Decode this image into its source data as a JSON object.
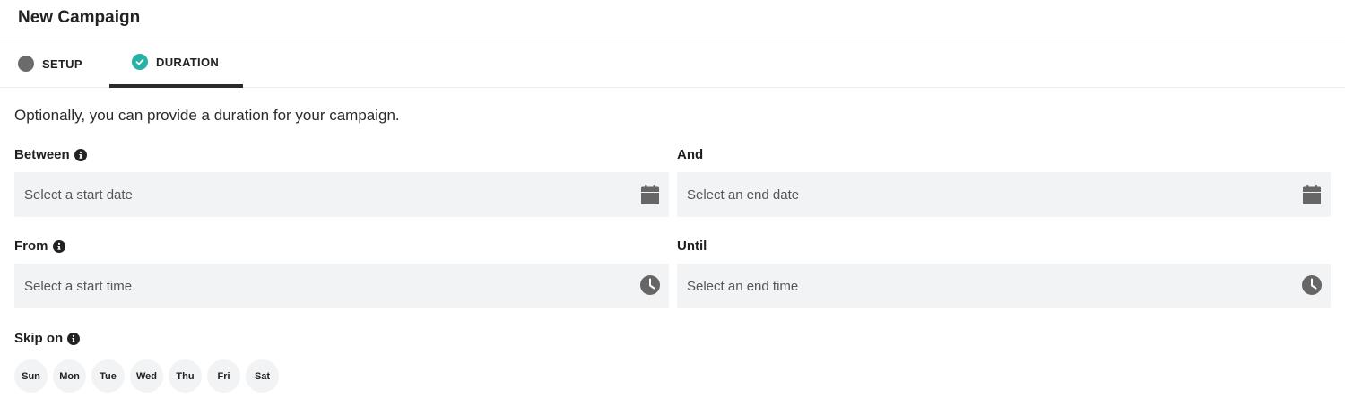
{
  "header": {
    "title": "New Campaign"
  },
  "tabs": [
    {
      "label": "SETUP",
      "icon": "status-dot-icon"
    },
    {
      "label": "DURATION",
      "icon": "check-circle-icon",
      "active": true
    }
  ],
  "intro": "Optionally, you can provide a duration for your campaign.",
  "fields": {
    "between": {
      "label": "Between",
      "placeholder": "Select a start date",
      "icon": "calendar-icon"
    },
    "and": {
      "label": "And",
      "placeholder": "Select an end date",
      "icon": "calendar-icon"
    },
    "from": {
      "label": "From",
      "placeholder": "Select a start time",
      "icon": "clock-icon"
    },
    "until": {
      "label": "Until",
      "placeholder": "Select an end time",
      "icon": "clock-icon"
    }
  },
  "skip_on": {
    "label": "Skip on",
    "days": [
      "Sun",
      "Mon",
      "Tue",
      "Wed",
      "Thu",
      "Fri",
      "Sat"
    ]
  },
  "colors": {
    "accent": "#26b3a4",
    "input_bg": "#f2f3f4",
    "tab_underline": "#2b2b2b"
  }
}
